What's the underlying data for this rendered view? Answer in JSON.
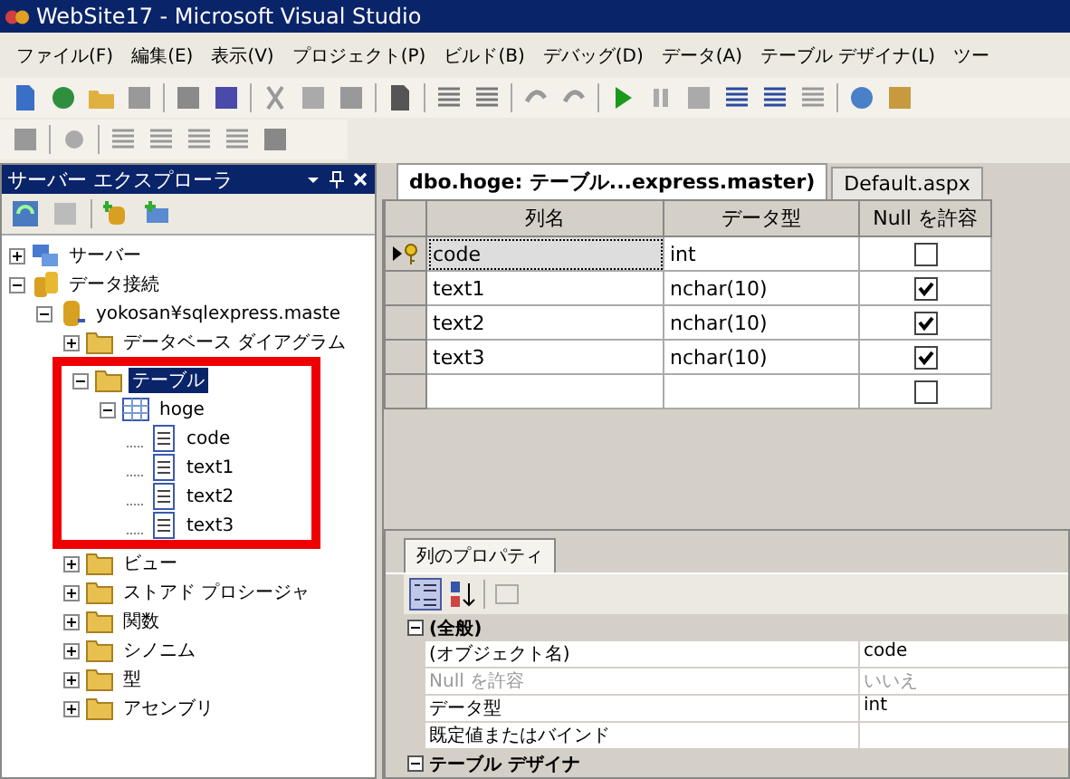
{
  "window": {
    "title": "WebSite17 - Microsoft Visual Studio"
  },
  "menu": [
    "ファイル(F)",
    "編集(E)",
    "表示(V)",
    "プロジェクト(P)",
    "ビルド(B)",
    "デバッグ(D)",
    "データ(A)",
    "テーブル デザイナ(L)",
    "ツー"
  ],
  "server_explorer": {
    "title": "サーバー エクスプローラ",
    "tree": [
      {
        "label": "サーバー",
        "kind": "server",
        "expanded": false,
        "selected": false
      },
      {
        "label": "データ接続",
        "kind": "database",
        "expanded": true,
        "selected": false,
        "children": [
          {
            "label": "yokosan¥sqlexpress.maste",
            "kind": "connection",
            "expanded": true,
            "selected": false,
            "children": [
              {
                "label": "データベース ダイアグラム",
                "kind": "folder",
                "expanded": false,
                "selected": false
              },
              {
                "label": "テーブル",
                "kind": "folder",
                "expanded": true,
                "selected": true,
                "highlighted": true,
                "children": [
                  {
                    "label": "hoge",
                    "kind": "table",
                    "expanded": true,
                    "selected": false,
                    "children": [
                      {
                        "label": "code",
                        "kind": "column",
                        "selected": false
                      },
                      {
                        "label": "text1",
                        "kind": "column",
                        "selected": false
                      },
                      {
                        "label": "text2",
                        "kind": "column",
                        "selected": false
                      },
                      {
                        "label": "text3",
                        "kind": "column",
                        "selected": false
                      }
                    ]
                  }
                ]
              },
              {
                "label": "ビュー",
                "kind": "folder",
                "expanded": false,
                "selected": false
              },
              {
                "label": "ストアド プロシージャ",
                "kind": "folder",
                "expanded": false,
                "selected": false
              },
              {
                "label": "関数",
                "kind": "folder",
                "expanded": false,
                "selected": false
              },
              {
                "label": "シノニム",
                "kind": "folder",
                "expanded": false,
                "selected": false
              },
              {
                "label": "型",
                "kind": "folder",
                "expanded": false,
                "selected": false
              },
              {
                "label": "アセンブリ",
                "kind": "folder",
                "expanded": false,
                "selected": false
              }
            ]
          }
        ]
      }
    ]
  },
  "tabs": [
    {
      "label": "dbo.hoge: テーブル...express.master)",
      "selected": true
    },
    {
      "label": "Default.aspx",
      "selected": false
    }
  ],
  "table": {
    "columns": [
      "列名",
      "データ型",
      "Null を許容"
    ],
    "rows": [
      {
        "name": "code",
        "type": "int",
        "allow_null": false,
        "primary_key": true,
        "current": true
      },
      {
        "name": "text1",
        "type": "nchar(10)",
        "allow_null": true,
        "primary_key": false,
        "current": false
      },
      {
        "name": "text2",
        "type": "nchar(10)",
        "allow_null": true,
        "primary_key": false,
        "current": false
      },
      {
        "name": "text3",
        "type": "nchar(10)",
        "allow_null": true,
        "primary_key": false,
        "current": false
      },
      {
        "allow_null": false,
        "primary_key": false,
        "current": false
      }
    ]
  },
  "properties": {
    "tab": "列のプロパティ",
    "categories": [
      {
        "label": "(全般)",
        "expanded": true,
        "rows": [
          {
            "name": "(オブジェクト名)",
            "value": "code",
            "disabled": false
          },
          {
            "name": "Null を許容",
            "value": "いいえ",
            "disabled": true
          },
          {
            "name": "データ型",
            "value": "int",
            "disabled": false
          },
          {
            "name": "既定値またはバインド",
            "disabled": false
          }
        ]
      },
      {
        "label": "テーブル デザイナ",
        "expanded": true
      }
    ]
  }
}
